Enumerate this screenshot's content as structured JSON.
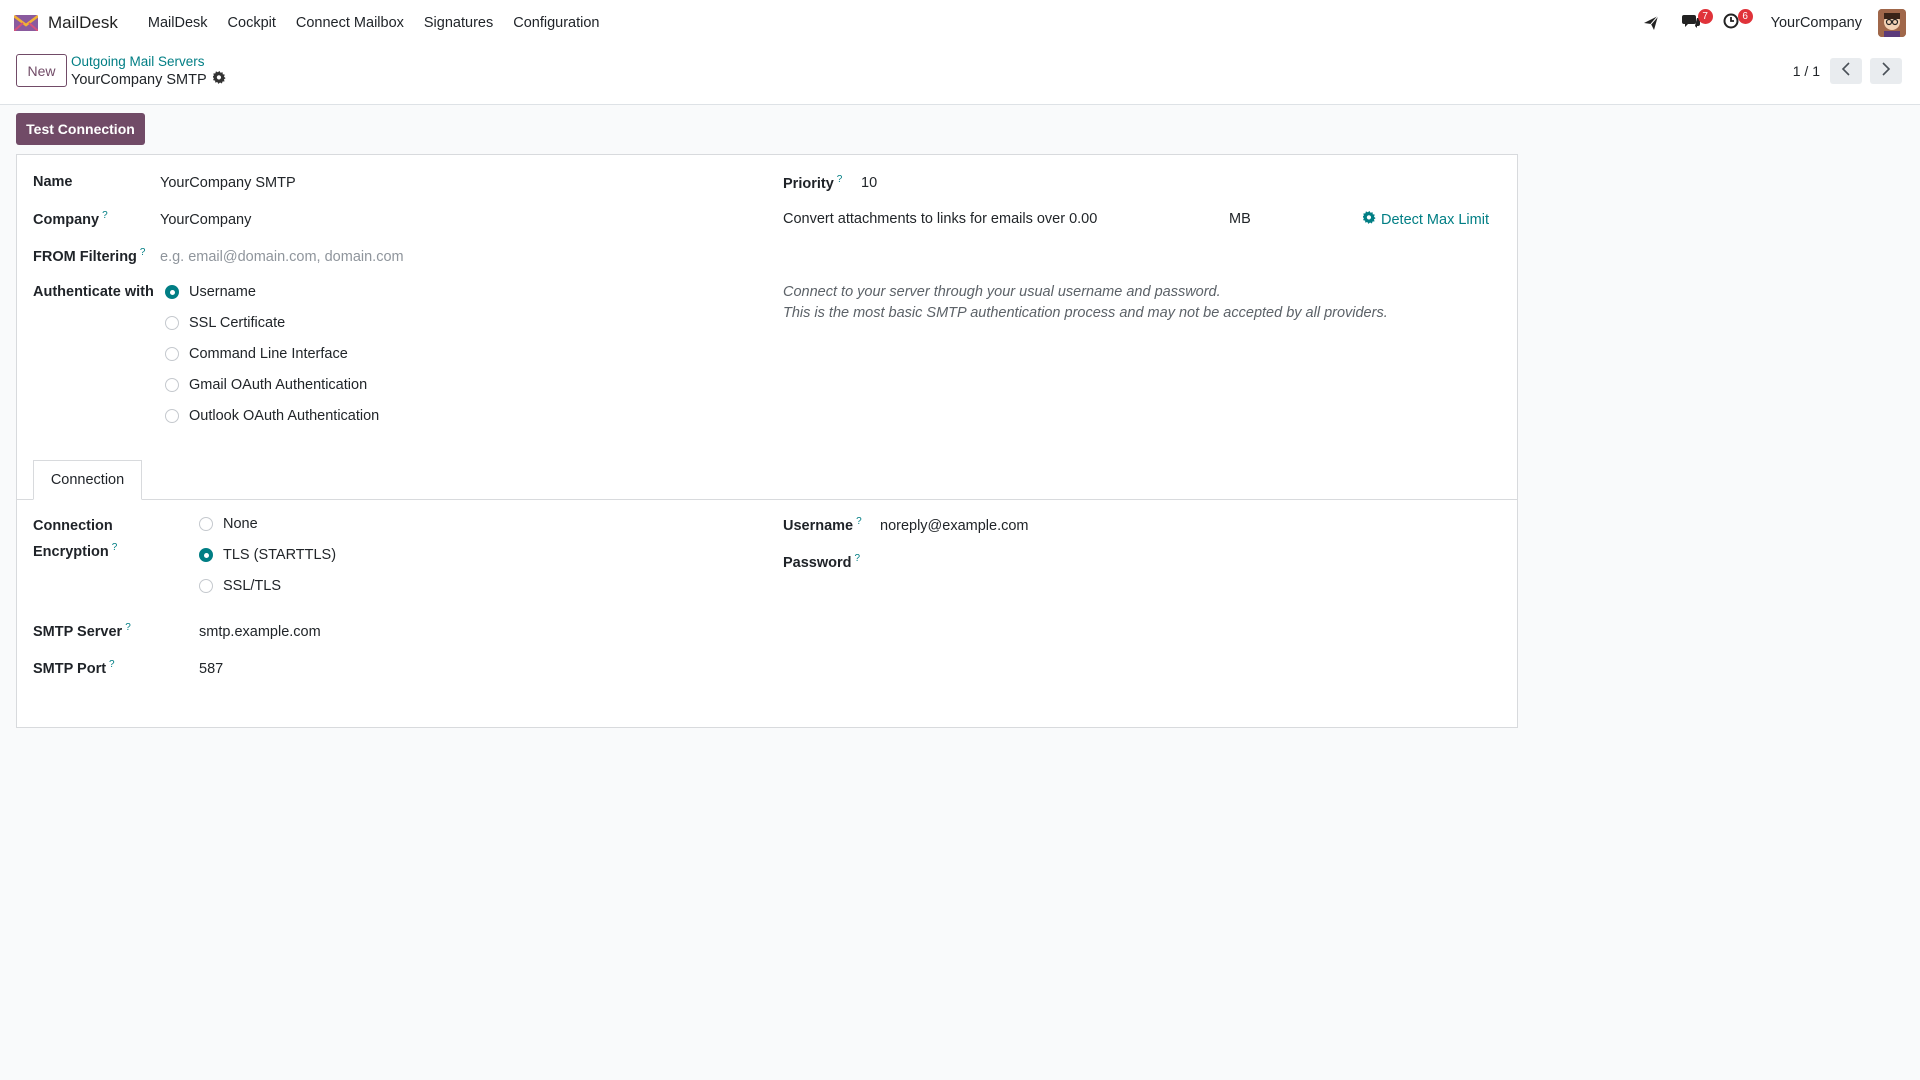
{
  "app": {
    "name": "MailDesk",
    "menu": [
      "MailDesk",
      "Cockpit",
      "Connect Mailbox",
      "Signatures",
      "Configuration"
    ],
    "notifications": {
      "messages_count": "7",
      "activities_count": "6"
    },
    "company": "YourCompany"
  },
  "control_panel": {
    "new_label": "New",
    "breadcrumb_parent": "Outgoing Mail Servers",
    "breadcrumb_current": "YourCompany SMTP",
    "pager_value": "1 / 1"
  },
  "actions": {
    "test_connection": "Test Connection"
  },
  "form": {
    "name_label": "Name",
    "name_value": "YourCompany SMTP",
    "company_label": "Company",
    "company_value": "YourCompany",
    "from_filter_label": "FROM Filtering",
    "from_filter_placeholder": "e.g. email@domain.com, domain.com",
    "auth_label": "Authenticate with",
    "auth_options": [
      "Username",
      "SSL Certificate",
      "Command Line Interface",
      "Gmail OAuth Authentication",
      "Outlook OAuth Authentication"
    ],
    "auth_selected": "Username",
    "priority_label": "Priority",
    "priority_value": "10",
    "attachments_label": "Convert attachments to links for emails over 0.00",
    "attachments_unit": "MB",
    "detect_label": "Detect Max Limit",
    "auth_help_line1": "Connect to your server through your usual username and password.",
    "auth_help_line2": "This is the most basic SMTP authentication process and may not be accepted by all providers."
  },
  "tabs": [
    "Connection"
  ],
  "connection": {
    "encryption_label_line1": "Connection",
    "encryption_label_line2": "Encryption",
    "encryption_options": [
      "None",
      "TLS (STARTTLS)",
      "SSL/TLS"
    ],
    "encryption_selected": "TLS (STARTTLS)",
    "smtp_server_label": "SMTP Server",
    "smtp_server_value": "smtp.example.com",
    "smtp_port_label": "SMTP Port",
    "smtp_port_value": "587",
    "username_label": "Username",
    "username_value": "noreply@example.com",
    "password_label": "Password",
    "help_marker": "?"
  },
  "colors": {
    "brand": "#714b67",
    "accent": "#017e84",
    "badge": "#e0333a"
  },
  "icons": [
    "maildesk-logo-icon",
    "paper-plane-icon",
    "chat-icon",
    "clock-icon",
    "gear-icon",
    "chevron-left-icon",
    "chevron-right-icon"
  ]
}
